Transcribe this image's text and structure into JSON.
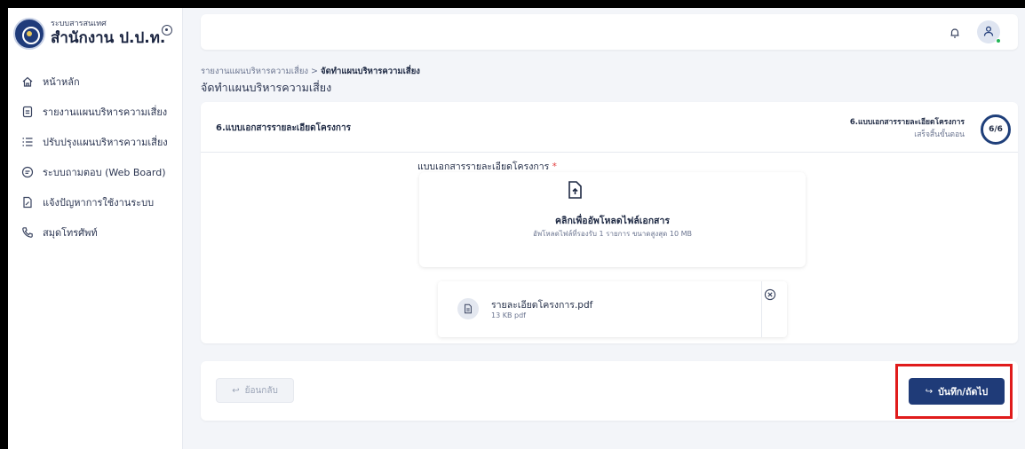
{
  "brand": {
    "subtitle": "ระบบสารสนเทศ",
    "title": "สำนักงาน ป.ป.ท."
  },
  "sidebar": {
    "items": [
      {
        "label": "หน้าหลัก",
        "icon": "home-icon"
      },
      {
        "label": "รายงานแผนบริหารความเสี่ยง",
        "icon": "document-icon"
      },
      {
        "label": "ปรับปรุงแผนบริหารความเสี่ยง",
        "icon": "list-icon"
      },
      {
        "label": "ระบบถามตอบ (Web Board)",
        "icon": "chat-icon"
      },
      {
        "label": "แจ้งปัญหาการใช้งานระบบ",
        "icon": "edit-document-icon"
      },
      {
        "label": "สมุดโทรศัพท์",
        "icon": "phone-icon"
      }
    ]
  },
  "header": {
    "notification_icon": "bell-icon",
    "user_icon": "user-icon",
    "status_color": "#22b455"
  },
  "breadcrumb": {
    "parent": "รายงานแผนบริหารความเสี่ยง",
    "separator": " > ",
    "current": "จัดทำแผนบริหารความเสี่ยง"
  },
  "page": {
    "title": "จัดทำแผนบริหารความเสี่ยง"
  },
  "section": {
    "title": "6.แบบเอกสารรายละเอียดโครงการ",
    "step_label": "6.แบบเอกสารรายละเอียดโครงการ",
    "step_status": "เสร็จสิ้นขั้นตอน",
    "step_progress": "6/6"
  },
  "upload": {
    "field_label": "แบบเอกสารรายละเอียดโครงการ",
    "required_mark": "*",
    "title": "คลิกเพื่ออัพโหลดไฟล์เอกสาร",
    "hint": "อัพโหลดไฟล์ที่รองรับ 1 รายการ ขนาดสูงสุด 10 MB"
  },
  "file": {
    "name": "รายละเอียดโครงการ.pdf",
    "meta": "13 KB pdf"
  },
  "footer": {
    "back_label": "ย้อนกลับ",
    "save_label": "บันทึก/ถัดไป"
  },
  "colors": {
    "primary": "#1f3b78",
    "highlight_border": "#e01b1b"
  }
}
